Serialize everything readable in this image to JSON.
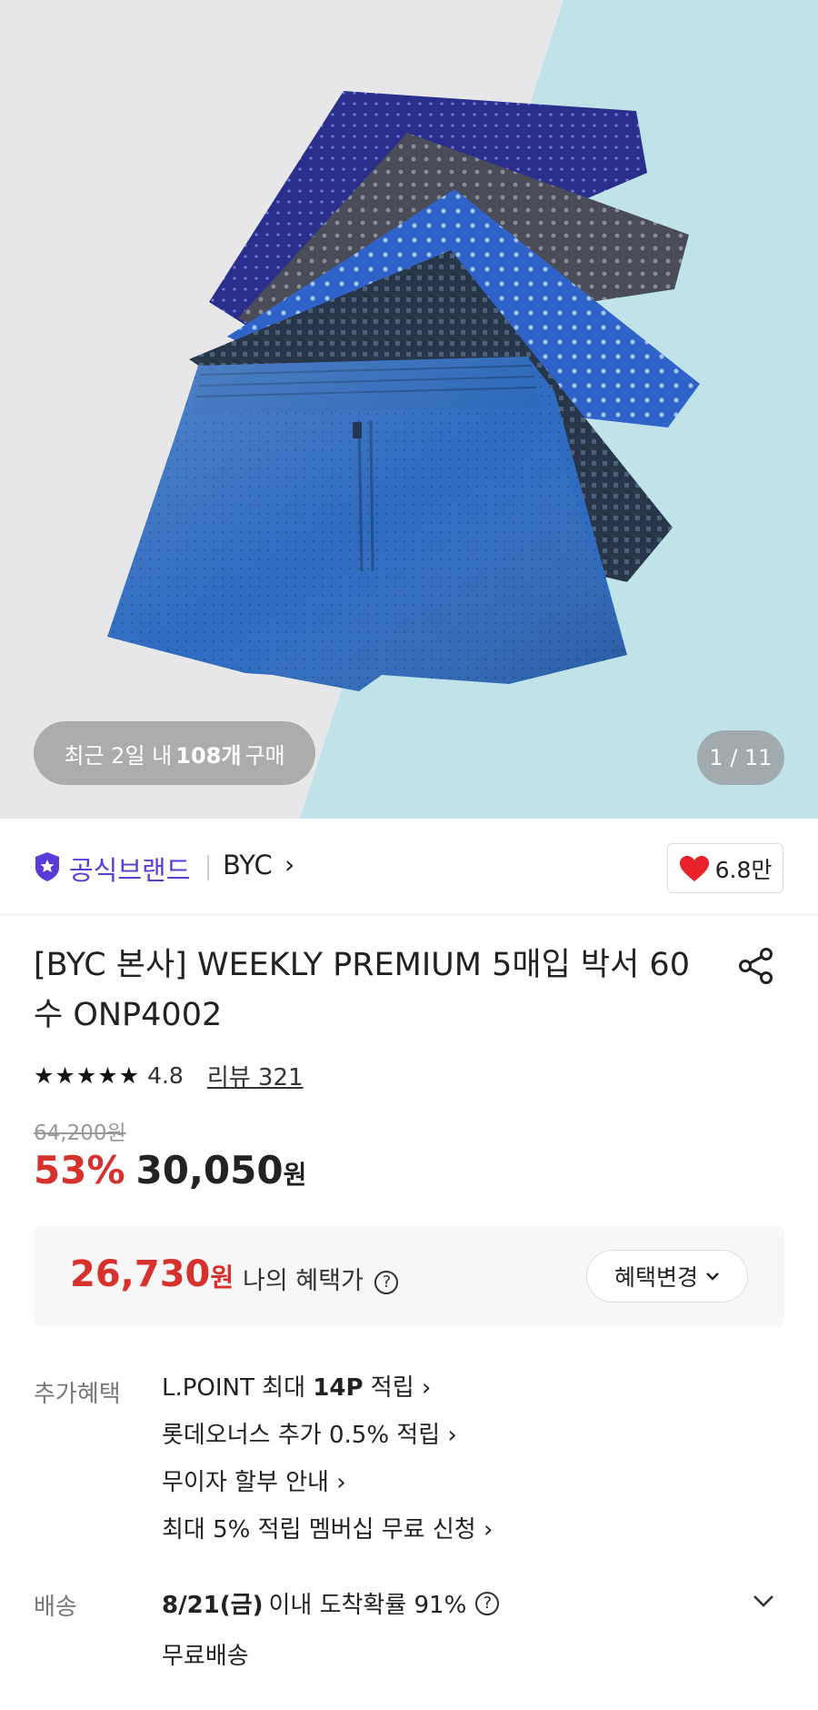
{
  "hero": {
    "recent_prefix": "최근 2일 내",
    "recent_count": "108개",
    "recent_suffix": "구매",
    "pager": "1 / 11"
  },
  "brand": {
    "official_label": "공식브랜드",
    "name": "BYC",
    "chevron": "›",
    "likes": "6.8만"
  },
  "product": {
    "title": "[BYC 본사] WEEKLY PREMIUM 5매입 박서 60수 ONP4002",
    "stars": "★★★★★",
    "rating": "4.8",
    "review_link": "리뷰 321",
    "original_price": "64,200원",
    "discount": "53%",
    "price": "30,050",
    "won": "원"
  },
  "benefit": {
    "price": "26,730",
    "won": "원",
    "label": "나의 혜택가",
    "help": "?",
    "change_label": "혜택변경"
  },
  "extra": {
    "label": "추가혜택",
    "items": [
      {
        "pre": "L.POINT 최대 ",
        "bold": "14P",
        "post": " 적립 ›"
      },
      {
        "pre": "롯데오너스 추가 0.5% 적립 ›",
        "bold": "",
        "post": ""
      },
      {
        "pre": "무이자 할부 안내 ›",
        "bold": "",
        "post": ""
      },
      {
        "pre": "최대 5% 적립 멤버십 무료 신청 ›",
        "bold": "",
        "post": ""
      }
    ]
  },
  "shipping": {
    "label": "배송",
    "date": "8/21(금)",
    "desc": "이내 도착확률 91%",
    "help": "?",
    "fee": "무료배송"
  },
  "colors": {
    "accent_red": "#d7312d",
    "brand_purple": "#5a3bd8",
    "heart": "#e8222a"
  }
}
